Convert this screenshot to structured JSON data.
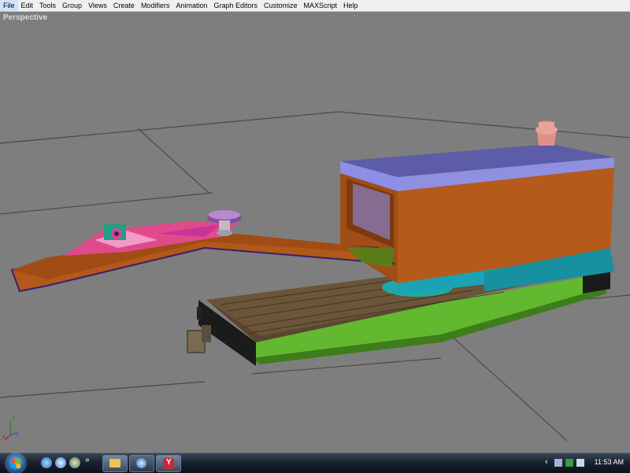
{
  "menu": [
    "File",
    "Edit",
    "Tools",
    "Group",
    "Views",
    "Create",
    "Modifiers",
    "Animation",
    "Graph Editors",
    "Customize",
    "MAXScript",
    "Help"
  ],
  "viewport": {
    "label": "Perspective"
  },
  "axes": {
    "z": "z",
    "x": "x",
    "y": "y"
  },
  "taskbar": {
    "quick_launch": [
      "show-desktop-icon",
      "internet-explorer-icon",
      "browser-icon"
    ],
    "overflow": "»",
    "buttons": [
      "folder-icon",
      "globe-icon",
      "3dsmax-icon"
    ]
  },
  "tray": {
    "expand": "‹",
    "time": "11:53 AM"
  },
  "colors": {
    "viewport_bg": "#7e7e7e",
    "cab_orange": "#b35a1a",
    "cab_roof": "#5a5a9a",
    "platform_green": "#6cc23a",
    "cyan_base": "#1ba3b5",
    "boom_pink": "#e04a8a"
  }
}
